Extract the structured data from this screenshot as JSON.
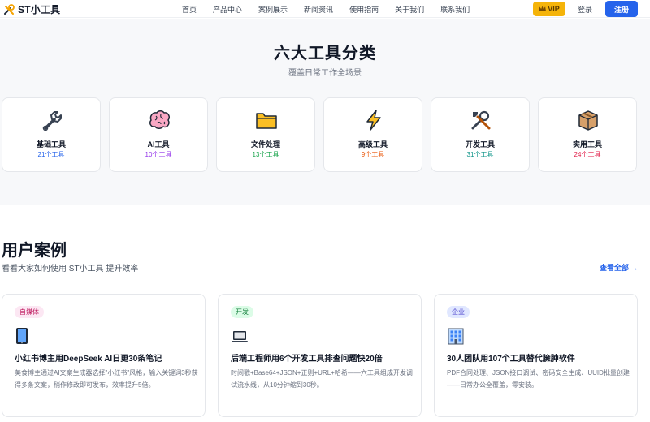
{
  "header": {
    "logo_text": "ST小工具",
    "nav": [
      "首页",
      "产品中心",
      "案例展示",
      "新闻资讯",
      "使用指南",
      "关于我们",
      "联系我们"
    ],
    "vip_label": "VIP",
    "login_label": "登录",
    "register_label": "注册"
  },
  "categories": {
    "title": "六大工具分类",
    "subtitle": "覆盖日常工作全场景",
    "items": [
      {
        "name": "基础工具",
        "count": "21个工具",
        "icon": "wrench-icon",
        "color": "#2563eb"
      },
      {
        "name": "AI工具",
        "count": "10个工具",
        "icon": "brain-icon",
        "color": "#9333ea"
      },
      {
        "name": "文件处理",
        "count": "13个工具",
        "icon": "folder-icon",
        "color": "#16a34a"
      },
      {
        "name": "高级工具",
        "count": "9个工具",
        "icon": "lightning-icon",
        "color": "#ea580c"
      },
      {
        "name": "开发工具",
        "count": "31个工具",
        "icon": "tools-icon",
        "color": "#0d9488"
      },
      {
        "name": "实用工具",
        "count": "24个工具",
        "icon": "package-icon",
        "color": "#e11d48"
      }
    ]
  },
  "cases": {
    "title": "用户案例",
    "subtitle": "看看大家如何使用 ST小工具 提升效率",
    "view_all": "查看全部 →",
    "items": [
      {
        "tag": "自媒体",
        "tag_bg": "#fce7f3",
        "tag_color": "#be185d",
        "icon": "phone-icon",
        "title": "小红书博主用DeepSeek AI日更30条笔记",
        "desc": "美食博主通过AI文案生成器选择\"小红书\"风格，输入关键词3秒获得多条文案，稍作修改即可发布，效率提升5倍。"
      },
      {
        "tag": "开发",
        "tag_bg": "#dcfce7",
        "tag_color": "#15803d",
        "icon": "laptop-icon",
        "title": "后端工程师用6个开发工具排查问题快20倍",
        "desc": "时间戳+Base64+JSON+正则+URL+哈希——六工具组成开发调试流水线，从10分钟缩到30秒。"
      },
      {
        "tag": "企业",
        "tag_bg": "#e0e7ff",
        "tag_color": "#4338ca",
        "icon": "building-icon",
        "title": "30人团队用107个工具替代臃肿软件",
        "desc": "PDF合同处理、JSON接口调试、密码安全生成、UUID批量创建——日常办公全覆盖，零安装。"
      }
    ]
  }
}
